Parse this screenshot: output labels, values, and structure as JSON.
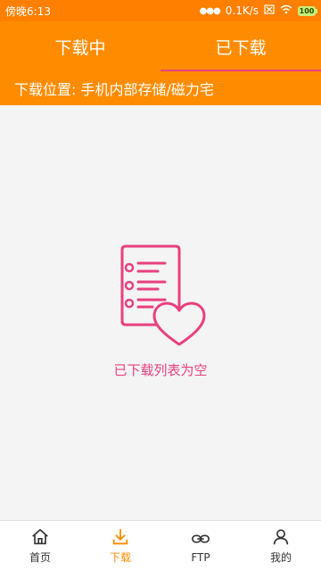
{
  "status_bar": {
    "time": "傍晚6:13",
    "speed": "0.1K/s",
    "battery": "100"
  },
  "tabs": [
    {
      "label": "下载中",
      "active": false
    },
    {
      "label": "已下载",
      "active": true
    }
  ],
  "location": "下载位置: 手机内部存储/磁力宅",
  "empty_state": {
    "text": "已下载列表为空"
  },
  "bottom_nav": [
    {
      "label": "首页",
      "icon": "home-icon",
      "active": false
    },
    {
      "label": "下载",
      "icon": "download-icon",
      "active": true
    },
    {
      "label": "FTP",
      "icon": "link-icon",
      "active": false
    },
    {
      "label": "我的",
      "icon": "profile-icon",
      "active": false
    }
  ],
  "colors": {
    "accent": "#ff8c00",
    "status_bar": "#ff8000",
    "pink": "#e8407f",
    "background": "#f4f4f4"
  }
}
